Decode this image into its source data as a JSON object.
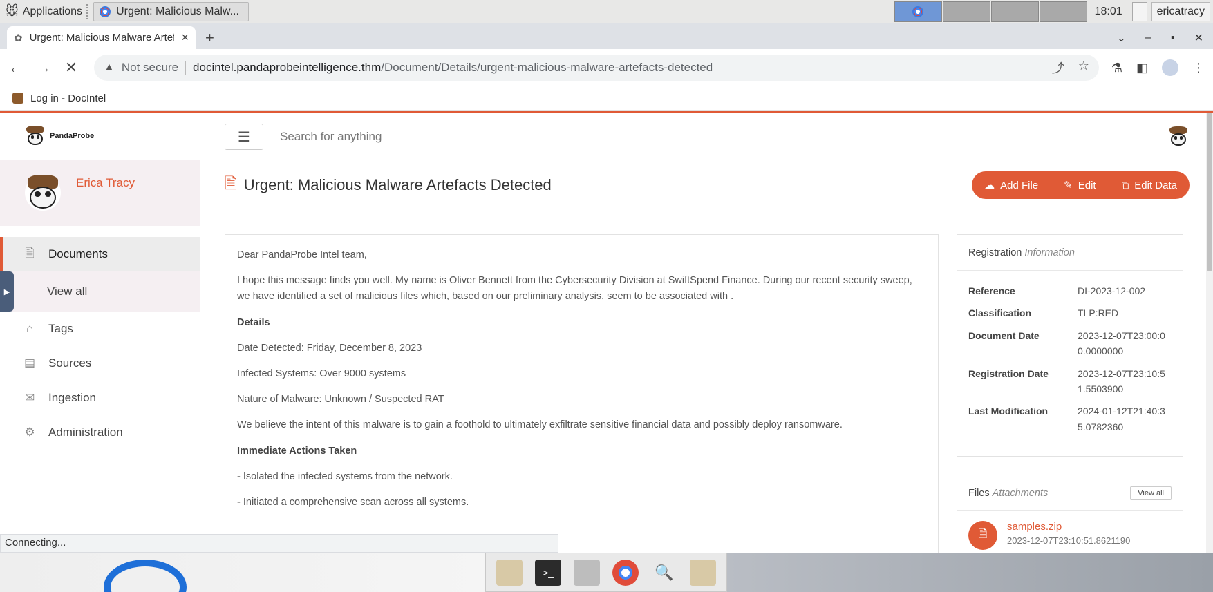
{
  "os": {
    "applications_label": "Applications",
    "task_title": "Urgent: Malicious Malw...",
    "clock": "18:01",
    "user": "ericatracy"
  },
  "browser": {
    "tab_title": "Urgent: Malicious Malware Artefacts Detected",
    "not_secure": "Not secure",
    "url_host": "docintel.pandaprobeintelligence.thm",
    "url_path": "/Document/Details/urgent-malicious-malware-artefacts-detected",
    "bookmark_label": "Log in - DocIntel",
    "status": "Connecting..."
  },
  "sidebar": {
    "brand": "PandaProbe",
    "user_name": "Erica Tracy",
    "items": [
      {
        "label": "Documents",
        "icon": "document-icon"
      },
      {
        "label": "View all"
      },
      {
        "label": "Tags",
        "icon": "tag-icon"
      },
      {
        "label": "Sources",
        "icon": "book-icon"
      },
      {
        "label": "Ingestion",
        "icon": "inbox-icon"
      },
      {
        "label": "Administration",
        "icon": "gear-icon"
      }
    ]
  },
  "header": {
    "search_placeholder": "Search for anything"
  },
  "document": {
    "title": "Urgent: Malicious Malware Artefacts Detected",
    "actions": {
      "add_file": "Add File",
      "edit": "Edit",
      "edit_data": "Edit Data"
    },
    "body": {
      "greeting": "Dear PandaProbe Intel team,",
      "intro": "I hope this message finds you well. My name is Oliver Bennett from the Cybersecurity Division at SwiftSpend Finance. During our recent security sweep, we have identified a set of malicious files which, based on our preliminary analysis, seem to be associated with .",
      "details_heading": "Details",
      "date_detected": "Date Detected: Friday, December 8, 2023",
      "infected": "Infected Systems: Over 9000 systems",
      "nature": "Nature of Malware: Unknown / Suspected RAT",
      "intent": "We believe the intent of this malware is to gain a foothold to ultimately exfiltrate sensitive financial data and possibly deploy ransomware.",
      "actions_heading": "Immediate Actions Taken",
      "action1": "- Isolated the infected systems from the network.",
      "action2": "- Initiated a comprehensive scan across all systems."
    }
  },
  "registration": {
    "heading": "Registration",
    "heading_sub": "Information",
    "rows": [
      {
        "key": "Reference",
        "value": "DI-2023-12-002"
      },
      {
        "key": "Classification",
        "value": "TLP:RED"
      },
      {
        "key": "Document Date",
        "value": "2023-12-07T23:00:00.0000000"
      },
      {
        "key": "Registration Date",
        "value": "2023-12-07T23:10:51.5503900"
      },
      {
        "key": "Last Modification",
        "value": "2024-01-12T21:40:35.0782360"
      }
    ]
  },
  "files": {
    "heading": "Files",
    "heading_sub": "Attachments",
    "view_all": "View all",
    "items": [
      {
        "name": "samples.zip",
        "date": "2023-12-07T23:10:51.8621190"
      }
    ]
  },
  "colors": {
    "accent": "#e05a36"
  }
}
